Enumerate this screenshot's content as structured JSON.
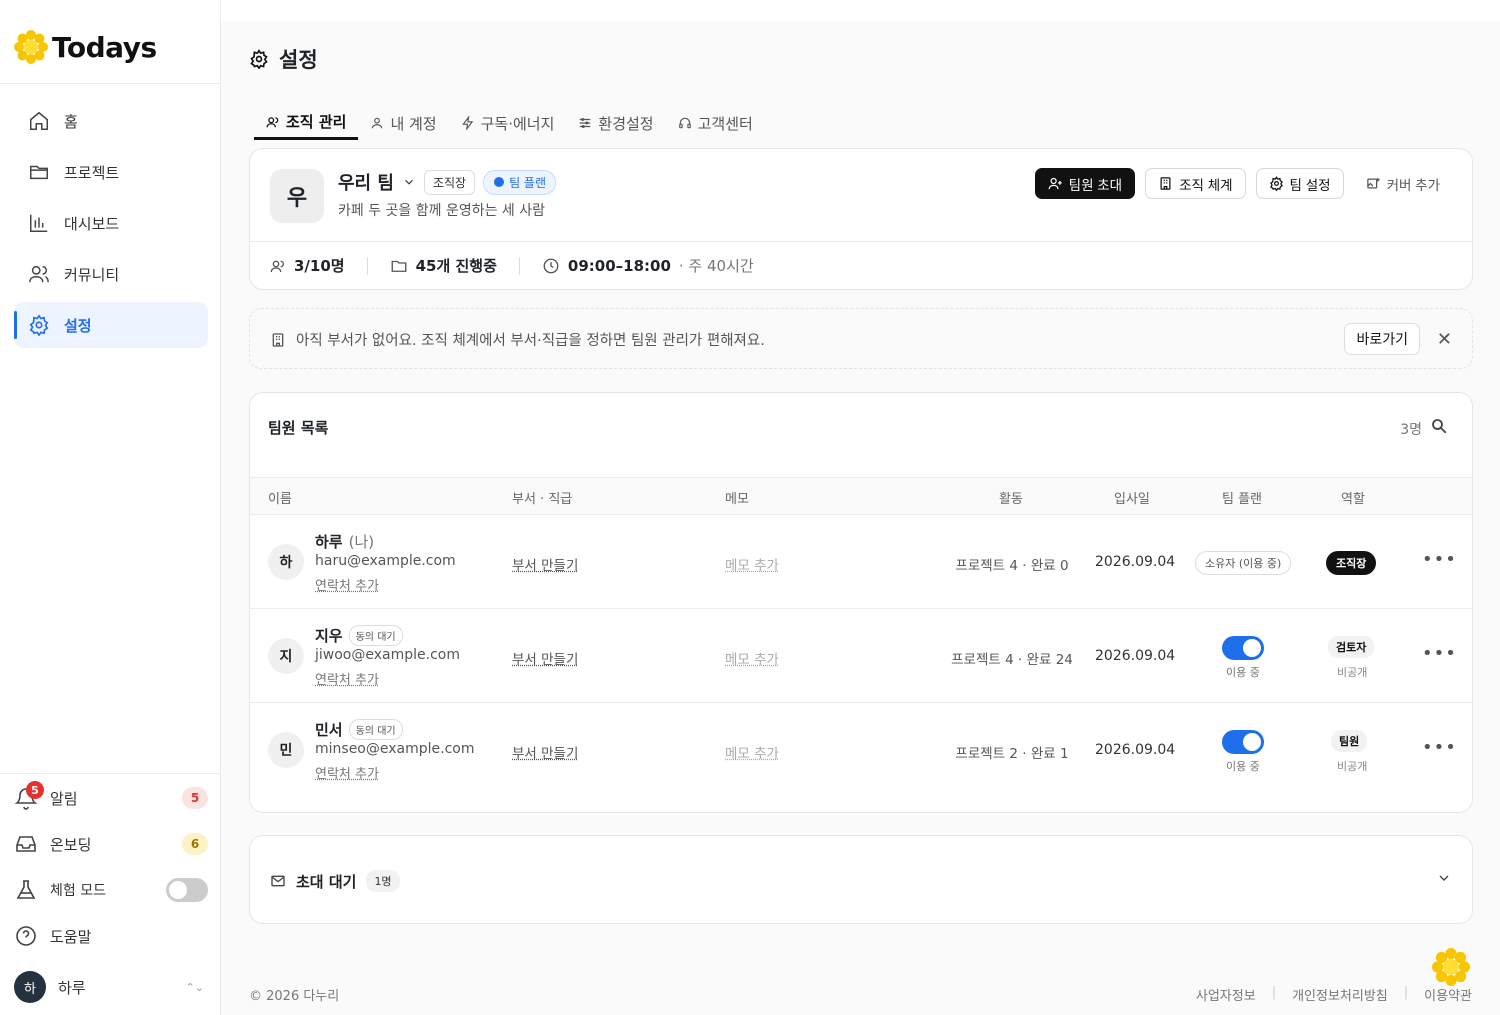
{
  "brand": {
    "name": "Todays"
  },
  "sidebar": {
    "items": [
      {
        "label": "홈",
        "icon": "home-icon"
      },
      {
        "label": "프로젝트",
        "icon": "folder-icon"
      },
      {
        "label": "대시보드",
        "icon": "bar-chart-icon"
      },
      {
        "label": "커뮤니티",
        "icon": "users-icon"
      },
      {
        "label": "설정",
        "icon": "gear-icon",
        "active": true
      }
    ],
    "bottom": {
      "alerts": {
        "label": "알림",
        "count": "5",
        "badge": "5"
      },
      "onboarding": {
        "label": "온보딩",
        "count": "6"
      },
      "trial": {
        "label": "체험 모드",
        "enabled": false
      },
      "help": {
        "label": "도움말"
      },
      "user": {
        "name": "하루",
        "initial": "하"
      }
    }
  },
  "page": {
    "title": "설정"
  },
  "tabs": [
    {
      "label": "조직 관리",
      "active": true
    },
    {
      "label": "내 계정"
    },
    {
      "label": "구독·에너지"
    },
    {
      "label": "환경설정"
    },
    {
      "label": "고객센터"
    }
  ],
  "org": {
    "initial": "우",
    "name": "우리 팀",
    "role_tag": "조직장",
    "plan_tag": "팀 플랜",
    "description": "카페 두 곳을 함께 운영하는 세 사람",
    "actions": {
      "invite": "팀원 초대",
      "structure": "조직 체계",
      "settings": "팀 설정",
      "cover": "커버 추가"
    },
    "stats": {
      "members": "3/10명",
      "projects": "45개 진행중",
      "hours": "09:00–18:00",
      "hours_sub": "· 주 40시간"
    }
  },
  "notice": {
    "text": "아직 부서가 없어요. 조직 체계에서 부서·직급을 정하면 팀원 관리가 편해져요.",
    "button": "바로가기"
  },
  "members": {
    "title": "팀원 목록",
    "count": "3명",
    "columns": {
      "name": "이름",
      "dept": "부서 · 직급",
      "memo": "메모",
      "activity": "활동",
      "joined": "입사일",
      "plan": "팀 플랜",
      "role": "역할"
    },
    "rows": [
      {
        "initial": "하",
        "name": "하루",
        "me": "(나)",
        "email": "haru@example.com",
        "contact": "연락처 추가",
        "dept": "부서 만들기",
        "memo": "메모 추가",
        "activity": "프로젝트 4 · 완료 0",
        "joined": "2026.09.04",
        "plan": "소유자 (이용 중)",
        "role": "조직장"
      },
      {
        "initial": "지",
        "name": "지우",
        "tag": "동의 대기",
        "email": "jiwoo@example.com",
        "contact": "연락처 추가",
        "dept": "부서 만들기",
        "memo": "메모 추가",
        "activity": "프로젝트 4 · 완료 24",
        "joined": "2026.09.04",
        "plan_sub": "이용 중",
        "plan_on": true,
        "role": "검토자",
        "role_sub": "비공개"
      },
      {
        "initial": "민",
        "name": "민서",
        "tag": "동의 대기",
        "email": "minseo@example.com",
        "contact": "연락처 추가",
        "dept": "부서 만들기",
        "memo": "메모 추가",
        "activity": "프로젝트 2 · 완료 1",
        "joined": "2026.09.04",
        "plan_sub": "이용 중",
        "plan_on": true,
        "role": "팀원",
        "role_sub": "비공개"
      }
    ]
  },
  "invites": {
    "title": "초대 대기",
    "count": "1명"
  },
  "footer": {
    "copyright": "© 2026 다누리",
    "links": [
      "사업자정보",
      "개인정보처리방침",
      "이용약관"
    ]
  },
  "colors": {
    "accent": "#1f6feb",
    "brand_yellow": "#f7c600",
    "danger": "#e5322d"
  }
}
